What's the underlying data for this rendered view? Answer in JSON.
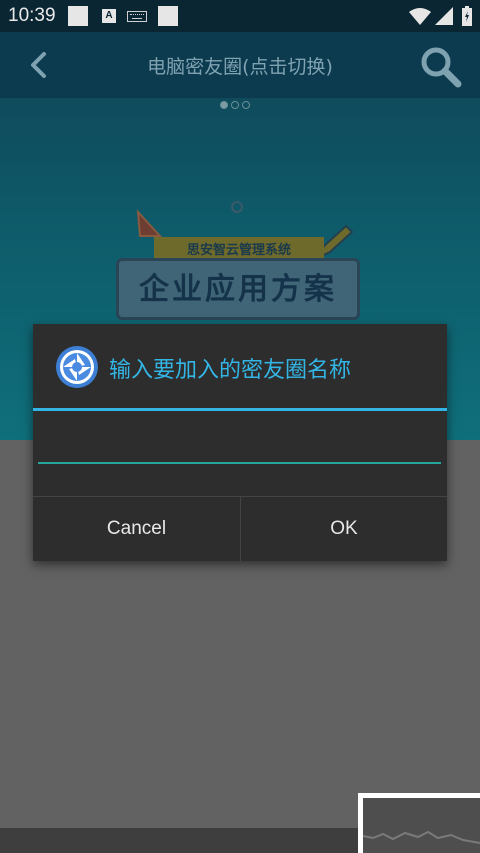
{
  "status_bar": {
    "time": "10:39",
    "a_badge": "A"
  },
  "app_bar": {
    "title": "电脑密友圈(点击切换)"
  },
  "banner": {
    "subtitle": "思安智云管理系统",
    "main_text": "企业应用方案"
  },
  "dialog": {
    "title": "输入要加入的密友圈名称",
    "input_value": "",
    "cancel_label": "Cancel",
    "ok_label": "OK"
  },
  "colors": {
    "accent": "#33b5e5",
    "input_underline": "#26a69a",
    "dialog_bg": "#2d2d2d",
    "app_bar_bg": "#0c3a4f"
  }
}
